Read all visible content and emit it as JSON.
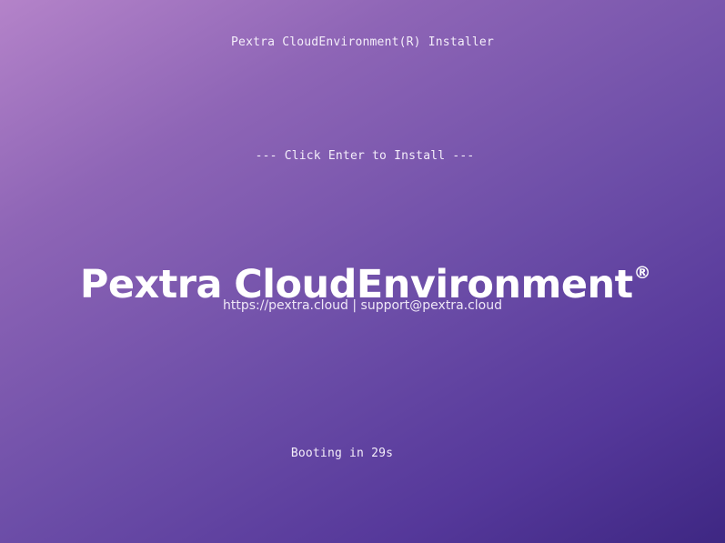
{
  "screen": {
    "title": "Pextra CloudEnvironment(R) Installer",
    "prompt": "--- Click Enter to Install ---",
    "boot_status": "Booting in 29s"
  },
  "logo": {
    "word_1": "Pextra",
    "word_2": "CloudEnvironment",
    "registered_mark": "®",
    "website": "https://pextra.cloud",
    "separator": "|",
    "email": "support@pextra.cloud"
  },
  "colors": {
    "background_top_left": "#b483c9",
    "background_bottom_right": "#3e2783",
    "text": "#ffffff"
  }
}
